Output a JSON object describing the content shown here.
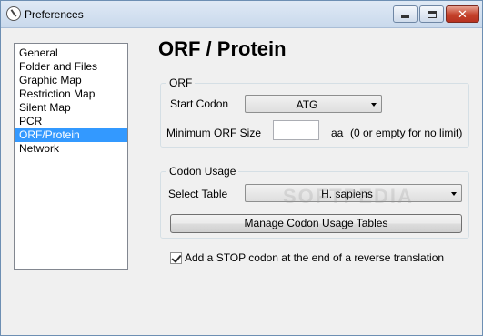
{
  "window": {
    "title": "Preferences"
  },
  "nav": {
    "items": [
      {
        "label": "General"
      },
      {
        "label": "Folder and Files"
      },
      {
        "label": "Graphic Map"
      },
      {
        "label": "Restriction Map"
      },
      {
        "label": "Silent Map"
      },
      {
        "label": "PCR"
      },
      {
        "label": "ORF/Protein"
      },
      {
        "label": "Network"
      }
    ],
    "selected": "ORF/Protein"
  },
  "page": {
    "title": "ORF / Protein"
  },
  "orf": {
    "legend": "ORF",
    "start_codon_label": "Start Codon",
    "start_codon_value": "ATG",
    "min_size_label": "Minimum ORF Size",
    "min_size_value": "",
    "min_size_unit": "aa",
    "min_size_hint": "(0 or empty for no limit)"
  },
  "codon": {
    "legend": "Codon Usage",
    "select_table_label": "Select Table",
    "select_table_value": "H. sapiens",
    "manage_button": "Manage Codon Usage Tables"
  },
  "options": {
    "stop_codon_label": "Add a STOP codon at the end of a reverse translation",
    "stop_codon_checked": true
  },
  "watermark": "SOFTPEDIA",
  "colors": {
    "selection": "#3399ff",
    "titlebar": "#c9d9ec",
    "close_button": "#c4412a"
  }
}
